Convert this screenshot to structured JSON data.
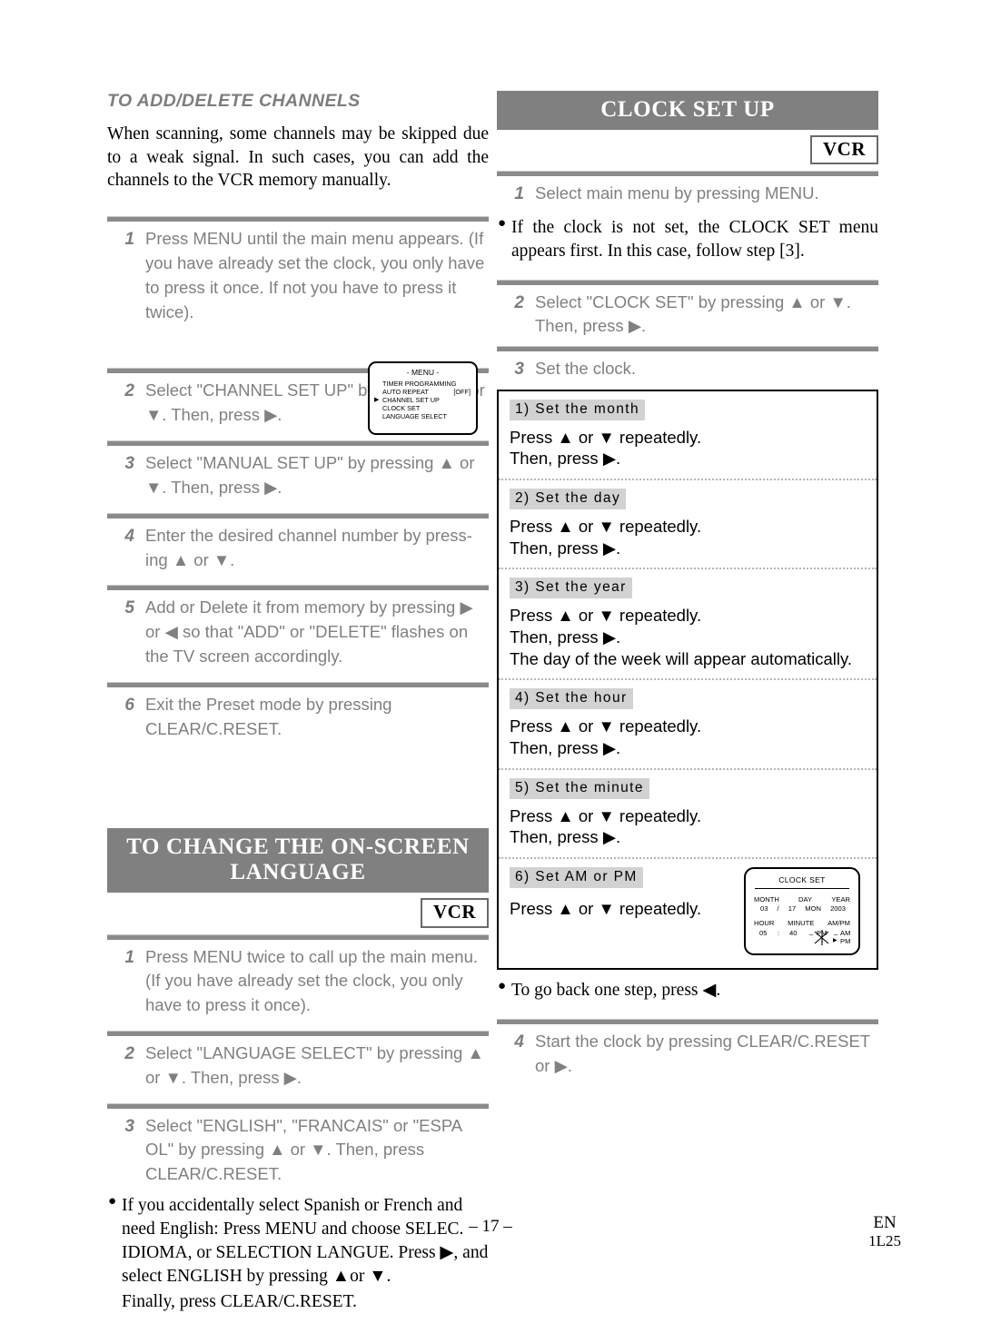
{
  "left_column": {
    "section_add_delete": {
      "heading": "TO ADD/DELETE CHANNELS",
      "intro": "When scanning, some channels may be skipped due to a weak signal. In such cases, you can add  the channels to the VCR memory manually.",
      "steps": [
        {
          "num": "1",
          "text": "Press MENU until the main menu appears. (If you have already set the clock, you only have to press it once.  If not you have to press it twice)."
        },
        {
          "num": "2",
          "text": "Select \"CHANNEL SET UP\" by pressing ▲ or ▼. Then, press ▶."
        },
        {
          "num": "3",
          "text": "Select \"MANUAL SET UP\" by pressing ▲ or ▼. Then, press ▶."
        },
        {
          "num": "4",
          "text": "Enter the desired channel number by press-ing ▲ or ▼."
        },
        {
          "num": "5",
          "text": "Add or Delete it from memory by pressing ▶ or ◀ so that \"ADD\" or \"DELETE\" flashes on the TV screen accordingly."
        },
        {
          "num": "6",
          "text": "Exit the Preset mode by pressing CLEAR/C.RESET."
        }
      ],
      "osd_menu": {
        "title": "- MENU -",
        "items": [
          {
            "label": "TIMER PROGRAMMING",
            "value": "",
            "selected": false
          },
          {
            "label": "AUTO REPEAT",
            "value": "[OFF]",
            "selected": false
          },
          {
            "label": "CHANNEL SET UP",
            "value": "",
            "selected": true
          },
          {
            "label": "CLOCK SET",
            "value": "",
            "selected": false
          },
          {
            "label": "LANGUAGE SELECT",
            "value": "",
            "selected": false
          }
        ],
        "caret": "▶"
      }
    },
    "section_language": {
      "heading": "TO CHANGE THE ON-SCREEN LANGUAGE",
      "badge": "VCR",
      "steps": [
        {
          "num": "1",
          "text": "Press MENU twice to call up the main menu. (If you have already set the clock, you only have to press it once)."
        },
        {
          "num": "2",
          "text": "Select \"LANGUAGE SELECT\" by pressing ▲ or ▼. Then, press ▶."
        },
        {
          "num": "3",
          "text": "Select \"ENGLISH\", \"FRANCAIS\" or \"ESPA  OL\" by pressing ▲ or ▼. Then, press CLEAR/C.RESET."
        }
      ],
      "note": "If you accidentally select Spanish or French and need English: Press MENU and choose SELEC. IDIOMA, or SELECTION LANGUE. Press ▶, and select ENGLISH by pressing ▲or ▼.",
      "note_final": "Finally, press CLEAR/C.RESET."
    }
  },
  "right_column": {
    "section_clock": {
      "heading": "CLOCK SET UP",
      "badge": "VCR",
      "step1": {
        "num": "1",
        "text": "Select main menu by pressing MENU."
      },
      "note1": "If the clock is not set, the CLOCK SET menu appears first. In this case, follow step [3].",
      "step2": {
        "num": "2",
        "text": "Select \"CLOCK SET\" by pressing ▲ or ▼. Then, press ▶."
      },
      "step3": {
        "num": "3",
        "text": "Set the clock."
      },
      "substeps": [
        {
          "label": "1) Set the month",
          "lines": [
            "Press ▲ or ▼ repeatedly.",
            "Then, press ▶."
          ]
        },
        {
          "label": "2) Set the day",
          "lines": [
            "Press ▲ or ▼ repeatedly.",
            "Then, press ▶."
          ]
        },
        {
          "label": "3) Set the year",
          "lines": [
            "Press ▲ or ▼ repeatedly.",
            "Then, press ▶.",
            "The day of the week will appear automatically."
          ]
        },
        {
          "label": "4) Set the hour",
          "lines": [
            "Press ▲ or ▼ repeatedly.",
            "Then, press ▶."
          ]
        },
        {
          "label": "5) Set the minute",
          "lines": [
            "Press ▲ or ▼ repeatedly.",
            "Then, press ▶."
          ]
        },
        {
          "label": "6) Set AM or PM",
          "lines": [
            "Press  ▲ or ▼ repeatedly."
          ]
        }
      ],
      "clock_osd": {
        "title": "CLOCK SET",
        "header_month": "MONTH",
        "header_day": "DAY",
        "header_year": "YEAR",
        "value_month": "03",
        "sep_date": "/",
        "value_day": "17",
        "value_weekday": "MON",
        "value_year": "2003",
        "header_hour": "HOUR",
        "header_minute": "MINUTE",
        "header_ampm": "AM/PM",
        "value_hour": "05",
        "sep_time": ":",
        "value_minute": "40",
        "ampm_flash_a": "PM",
        "ampm_option_am": "AM",
        "ampm_option_pm": "PM"
      },
      "note2": "To go back one step, press ◀.",
      "step4": {
        "num": "4",
        "text": "Start the clock by pressing CLEAR/C.RESET or ▶."
      }
    }
  },
  "footer": {
    "page_number": "– 17 –",
    "region": "EN",
    "code": "1L25"
  }
}
